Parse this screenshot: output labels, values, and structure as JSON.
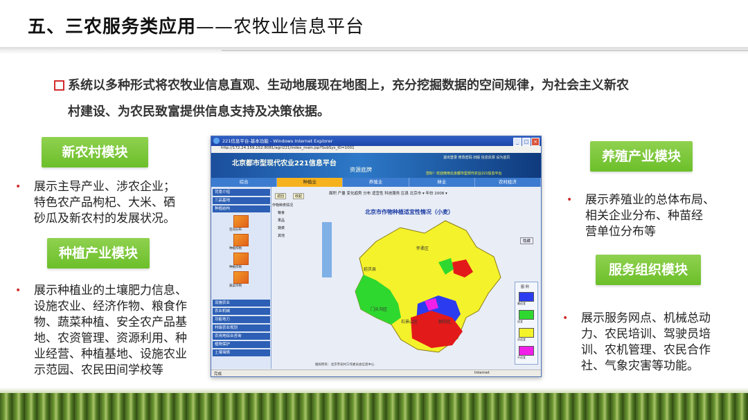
{
  "header": {
    "title_bold": "五、三农服务类应用",
    "title_thin": "——农牧业信息平台"
  },
  "intro": {
    "line1": "系统以多种形式将农牧业信息直观、生动地展现在地图上，充分挖掘数据的空间规律，为社会主义新农",
    "line2": "村建设、为农民致富提供信息支持及决策依据。"
  },
  "modules": {
    "new_village": {
      "tag": "新农村模块",
      "lines": [
        "展示主导产业、涉农企业；",
        "特色农产品枸杞、大米、硒",
        "砂瓜及新农村的发展状况。"
      ]
    },
    "planting": {
      "tag": "种植产业模块",
      "lines": [
        "展示种植业的土壤肥力信息、",
        "设施农业、经济作物、粮食作",
        "物、蔬菜种植、安全农产品基",
        "地、农资管理、资源利用、种",
        "业经营、种植基地、设施农业",
        "示范园、农民田间学校等"
      ]
    },
    "breeding": {
      "tag": "养殖产业模块",
      "lines": [
        "展示养殖业的总体布局、",
        "相关企业分布、种苗经",
        "营单位分布等"
      ]
    },
    "service": {
      "tag": "服务组织模块",
      "lines": [
        "展示服务网点、机械总动",
        "力、农民培训、驾驶员培",
        "训、农机管理、农民合作",
        "社、气象灾害等功能。"
      ]
    }
  },
  "bullet_char": "•",
  "screenshot": {
    "window_title": "221信息平台-基本功能 - Windows Internet Explorer",
    "url": "http://172.24.159.152:8081/agri221/index_main.jsp?SubSys_ID=1001",
    "banner_title": "北京都市型现代农业221信息平台",
    "banner_sub": "资源底牌",
    "banner_links": "退出登录  修改密码  旧版  信息反馈  设为首页",
    "banner_welcome": "您好！欢迎使用北京都市型现代农业221信息平台",
    "nav": [
      "综合",
      "种植业",
      "养殖业",
      "林业",
      "农村经济"
    ],
    "nav_active": 1,
    "sidebar_top": [
      "背景介绍",
      "三品基地",
      "种植结构"
    ],
    "sidebar_icons": [
      "空间分布",
      "种植作物",
      "种植作物",
      "蔬菜作物"
    ],
    "sidebar_bottom": [
      "设施农业",
      "农业机械",
      "功能地力",
      "村级农业规划",
      "农用地综合咨询",
      "植物保护",
      "土壤墒情"
    ],
    "tree_header": "作物种类情况",
    "tree_items": [
      "粮食",
      "果品",
      "蔬菜",
      "其他"
    ],
    "tree_buttons": [
      "返回",
      "收起"
    ],
    "content_tabs": "面积   产量   变化趋势   分布   适宜性   科技服务     区县 北京市  ▾   年份 2008 ▾",
    "map_title": "北京市作物种植适宜性情况（小麦）",
    "map_button": "隐藏",
    "map_labels": [
      "怀柔区",
      "延庆县",
      "门头沟区",
      "石景山区",
      "朝阳区"
    ],
    "legend_title": "图 例",
    "legend": [
      {
        "label": "最适宜",
        "color": "#2b3cf0"
      },
      {
        "label": "适宜",
        "color": "#2fd82f"
      },
      {
        "label": "次适宜",
        "color": "#f4f22a"
      },
      {
        "label": "不适宜",
        "color": "#f020e8"
      }
    ],
    "status_left": "完成",
    "status_right": "Internet",
    "footer_note": "版权所有：北京市农村工作委员会信息中心"
  }
}
